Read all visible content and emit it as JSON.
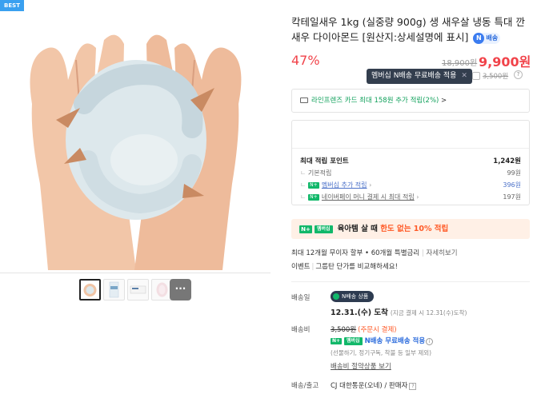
{
  "gallery": {
    "badge": "BEST",
    "thumbnails": [
      "shrimp-in-hands",
      "package-photo",
      "label-photo",
      "raw-shrimp-photo",
      "more"
    ],
    "more_label": "···"
  },
  "product": {
    "title": "칵테일새우 1kg (실중량 900g) 생 새우살 냉동 특대 깐새우 다이아몬드 [원산지:상세설명에 표시]",
    "npay_badge": "배송",
    "discount": "47%",
    "original_price": "18,900원",
    "sale_price": "9,900원"
  },
  "tooltip": {
    "text": "멤버십 N배송 무료배송 적용",
    "close": "✕",
    "ship_price": "3,500원",
    "help": "?"
  },
  "card_promo": {
    "text": "라인프렌즈 카드 최대 158원 추가 적립",
    "highlight": "(2%)",
    "chevron": ">"
  },
  "points": {
    "title": "최대 적립 포인트",
    "total": "1,242원",
    "rows": [
      {
        "label": "기본적립",
        "value": "99원"
      },
      {
        "badge": "N+",
        "label": "멤버십 추가 적립",
        "value": "396원"
      },
      {
        "badge": "N+",
        "label": "네이버페이 머니 결제 시 최대 적립",
        "value": "197원"
      }
    ]
  },
  "baby_banner": {
    "badge": "N+",
    "membership": "멤버십",
    "text": "육아템 살 때 ",
    "highlight": "한도 없는 10% 적립"
  },
  "promo": {
    "line1_text": "최대 12개월 무이자 할부 • 60개월 특별금리",
    "line1_link": "자세히보기",
    "line2_a": "이벤트",
    "line2_sep": "|",
    "line2_b": "그룹탄 단가를 비교해하세요!"
  },
  "shipping": {
    "delivery_label": "배송일",
    "delivery_badge": "N배송 상품",
    "delivery_date": "12.31.(수) 도착",
    "delivery_sub": "(지금 결제 시 12.31(수)도착)",
    "fee_label": "배송비",
    "fee_price": "3,500원",
    "fee_note_orange": "(주문시 결제)",
    "free_badge": "멤버십",
    "free_text": "N배송 무료배송 적용",
    "free_note": "(선물하기, 정기구독, 착불 등 일부 제외)",
    "free_link": "배송비 절약상품 보기",
    "carrier_label": "배송/출고",
    "carrier": "CJ 대한통운(오네) / 판매자",
    "carrier_help": "?"
  },
  "colors": {
    "accent_red": "#f1434a",
    "naver_green": "#12b86a",
    "tooltip_bg": "#333e4e",
    "banner_bg": "#fff0e6"
  }
}
